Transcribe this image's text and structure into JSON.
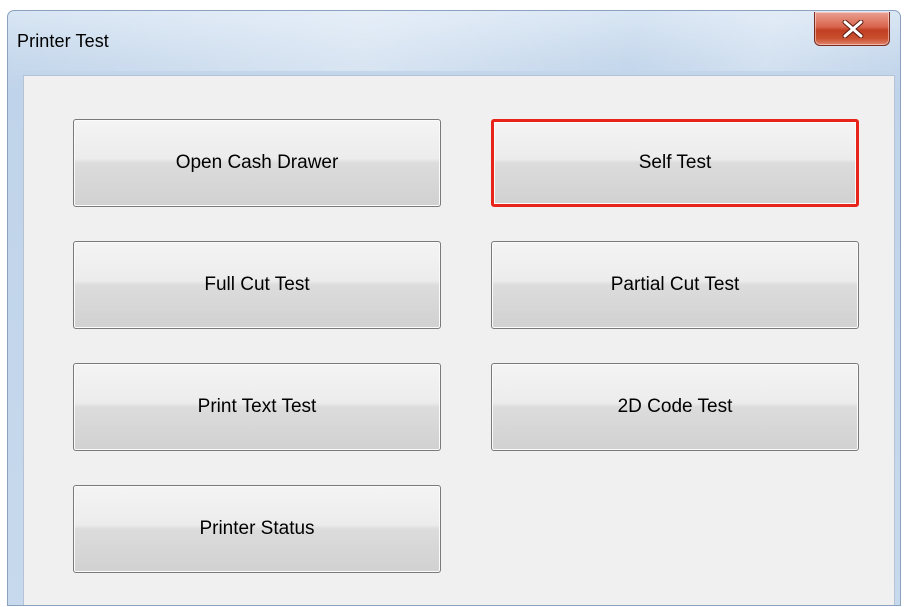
{
  "window": {
    "title": "Printer Test"
  },
  "buttons": {
    "open_cash_drawer": "Open Cash Drawer",
    "self_test": "Self Test",
    "full_cut_test": "Full Cut Test",
    "partial_cut_test": "Partial Cut Test",
    "print_text_test": "Print Text Test",
    "code_2d_test": "2D Code Test",
    "printer_status": "Printer Status"
  },
  "focused_button": "self_test",
  "icons": {
    "close": "close-icon"
  },
  "colors": {
    "focus_border": "#e8241a",
    "close_button": "#c9502f",
    "window_frame": "#c6d8ec",
    "client_background": "#f0f0f0"
  }
}
